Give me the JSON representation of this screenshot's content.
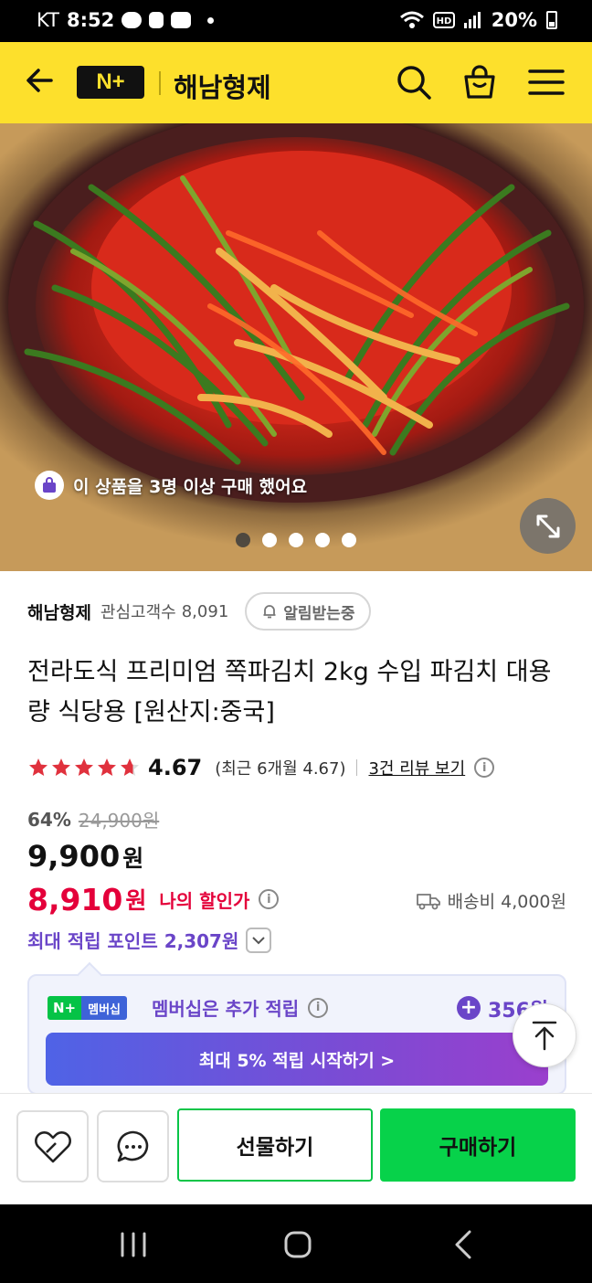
{
  "status_bar": {
    "carrier": "KT",
    "time": "8:52",
    "battery": "20%",
    "icons": [
      "talk-icon",
      "sim-icon",
      "voicemail-icon",
      "wifi-icon",
      "hd-icon",
      "signal-icon",
      "battery-icon"
    ]
  },
  "header": {
    "logo_text": "N+",
    "store_name": "해남형제",
    "icons": [
      "back-arrow-icon",
      "search-icon",
      "shopping-bag-icon",
      "menu-icon"
    ],
    "background_color": "#fde02c"
  },
  "hero": {
    "purchase_badge": "이 상품을 3명 이상 구매 했어요",
    "slide_count": 5,
    "active_slide": 1
  },
  "seller": {
    "name": "해남형제",
    "fans_label": "관심고객수",
    "fans_count": "8,091",
    "alarm_button": "알림받는중"
  },
  "product": {
    "title": "전라도식 프리미엄 쪽파김치 2kg 수입 파김치 대용량 식당용 [원산지:중국]",
    "rating_score": "4.67",
    "rating_stars_value": 4.67,
    "rating_recent": "(최근 6개월 4.67)",
    "review_link": "3건 리뷰 보기",
    "discount_rate": "64%",
    "original_price": "24,900원",
    "price": "9,900",
    "currency": "원",
    "my_price": "8,910",
    "my_price_label": "나의 할인가",
    "shipping": "배송비 4,000원",
    "max_points": "최대 적립 포인트 2,307원"
  },
  "membership": {
    "badge_logo": "N+",
    "badge_label": "멤버십",
    "text": "멤버십은 추가 적립",
    "amount": "356원",
    "cta": "최대 5% 적립 시작하기 >"
  },
  "action_bar": {
    "gift_button": "선물하기",
    "buy_button": "구매하기",
    "icons": [
      "wishlist-heart-icon",
      "chat-bubble-icon"
    ]
  },
  "accent_colors": {
    "price_red": "#e4003a",
    "point_purple": "#6a45c8",
    "buy_green": "#07d24a",
    "star_red": "#e0313d"
  }
}
